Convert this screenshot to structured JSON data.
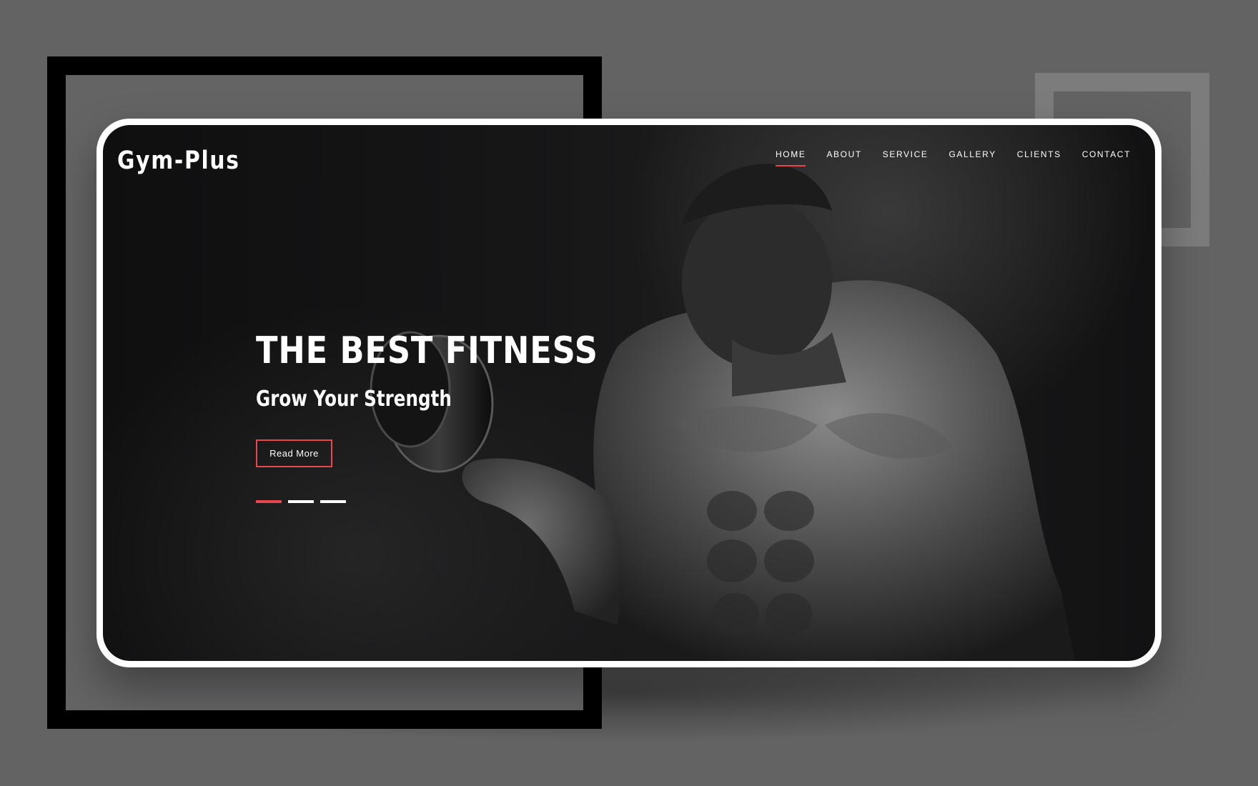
{
  "brand": {
    "logo": "Gym-Plus"
  },
  "nav": {
    "items": [
      {
        "label": "HOME",
        "active": true
      },
      {
        "label": "ABOUT",
        "active": false
      },
      {
        "label": "SERVICE",
        "active": false
      },
      {
        "label": "GALLERY",
        "active": false
      },
      {
        "label": "CLIENTS",
        "active": false
      },
      {
        "label": "CONTACT",
        "active": false
      }
    ]
  },
  "hero": {
    "title": "THE BEST FITNESS",
    "subtitle": "Grow Your Strength",
    "button_label": "Read More",
    "slider": {
      "count": 3,
      "active_index": 0
    }
  },
  "colors": {
    "accent": "#e8454c",
    "page_background": "#646364",
    "card_border": "#ffffff",
    "hero_background": "#151516"
  }
}
